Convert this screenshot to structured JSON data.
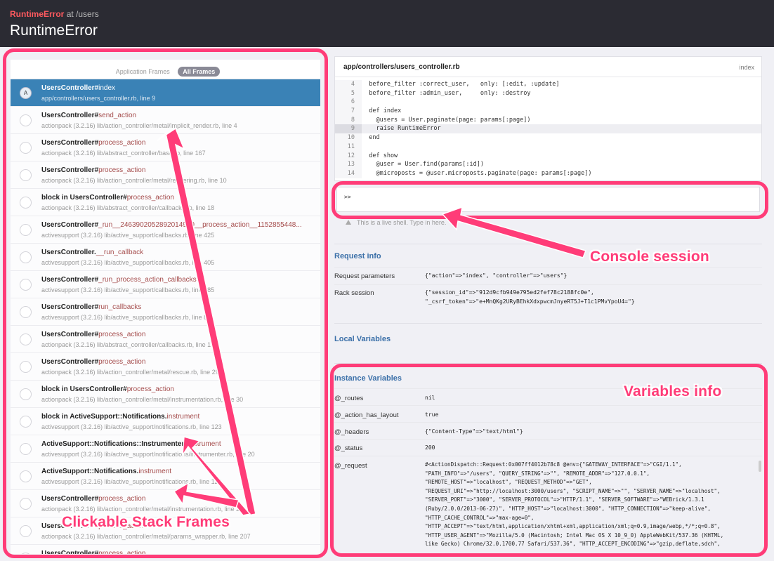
{
  "header": {
    "exception_class": "RuntimeError",
    "at_text": "at /users",
    "title": "RuntimeError"
  },
  "frames_panel": {
    "tabs": [
      "Application Frames",
      "All Frames"
    ],
    "active_tab": "All Frames",
    "frames": [
      {
        "cls": "UsersController",
        "sep": "#",
        "meth": "index",
        "loc": "app/controllers/users_controller.rb, line 9",
        "badge": "A",
        "selected": true
      },
      {
        "cls": "UsersController",
        "sep": "#",
        "meth": "send_action",
        "loc": "actionpack (3.2.16) lib/action_controller/metal/implicit_render.rb, line 4"
      },
      {
        "cls": "UsersController",
        "sep": "#",
        "meth": "process_action",
        "loc": "actionpack (3.2.16) lib/abstract_controller/base.rb, line 167"
      },
      {
        "cls": "UsersController",
        "sep": "#",
        "meth": "process_action",
        "loc": "actionpack (3.2.16) lib/action_controller/metal/rendering.rb, line 10"
      },
      {
        "cls": "block in UsersController",
        "sep": "#",
        "meth": "process_action",
        "loc": "actionpack (3.2.16) lib/abstract_controller/callbacks.rb, line 18"
      },
      {
        "cls": "UsersController",
        "sep": "#",
        "meth": "_run__2463902052892014980__process_action__1152855448...",
        "loc": "activesupport (3.2.16) lib/active_support/callbacks.rb, line 425"
      },
      {
        "cls": "UsersController",
        "sep": ".",
        "meth": "__run_callback",
        "loc": "activesupport (3.2.16) lib/active_support/callbacks.rb, line 405"
      },
      {
        "cls": "UsersController",
        "sep": "#",
        "meth": "_run_process_action_callbacks",
        "loc": "activesupport (3.2.16) lib/active_support/callbacks.rb, line 385"
      },
      {
        "cls": "UsersController",
        "sep": "#",
        "meth": "run_callbacks",
        "loc": "activesupport (3.2.16) lib/active_support/callbacks.rb, line 81"
      },
      {
        "cls": "UsersController",
        "sep": "#",
        "meth": "process_action",
        "loc": "actionpack (3.2.16) lib/abstract_controller/callbacks.rb, line 17"
      },
      {
        "cls": "UsersController",
        "sep": "#",
        "meth": "process_action",
        "loc": "actionpack (3.2.16) lib/action_controller/metal/rescue.rb, line 29"
      },
      {
        "cls": "block in UsersController",
        "sep": "#",
        "meth": "process_action",
        "loc": "actionpack (3.2.16) lib/action_controller/metal/instrumentation.rb, line 30"
      },
      {
        "cls": "block in ActiveSupport::Notifications",
        "sep": ".",
        "meth": "instrument",
        "loc": "activesupport (3.2.16) lib/active_support/notifications.rb, line 123"
      },
      {
        "cls": "ActiveSupport::Notifications::Instrumenter",
        "sep": "#",
        "meth": "instrument",
        "loc": "activesupport (3.2.16) lib/active_support/notifications/instrumenter.rb, line 20"
      },
      {
        "cls": "ActiveSupport::Notifications",
        "sep": ".",
        "meth": "instrument",
        "loc": "activesupport (3.2.16) lib/active_support/notifications.rb, line 123"
      },
      {
        "cls": "UsersController",
        "sep": "#",
        "meth": "process_action",
        "loc": "actionpack (3.2.16) lib/action_controller/metal/instrumentation.rb, line 29"
      },
      {
        "cls": "UsersController",
        "sep": "#",
        "meth": "process_action",
        "loc": "actionpack (3.2.16) lib/action_controller/metal/params_wrapper.rb, line 207"
      },
      {
        "cls": "UsersController",
        "sep": "#",
        "meth": "process_action",
        "loc": ""
      }
    ]
  },
  "code_panel": {
    "filename": "app/controllers/users_controller.rb",
    "index_label": "index",
    "highlight_line": "9",
    "lines": [
      {
        "n": "4",
        "t": "  before_filter :correct_user,   only: [:edit, :update]"
      },
      {
        "n": "5",
        "t": "  before_filter :admin_user,     only: :destroy"
      },
      {
        "n": "6",
        "t": ""
      },
      {
        "n": "7",
        "t": "  def index"
      },
      {
        "n": "8",
        "t": "    @users = User.paginate(page: params[:page])"
      },
      {
        "n": "9",
        "t": "    raise RuntimeError"
      },
      {
        "n": "10",
        "t": "  end"
      },
      {
        "n": "11",
        "t": ""
      },
      {
        "n": "12",
        "t": "  def show"
      },
      {
        "n": "13",
        "t": "    @user = User.find(params[:id])"
      },
      {
        "n": "14",
        "t": "    @microposts = @user.microposts.paginate(page: params[:page])"
      }
    ]
  },
  "console": {
    "prompt": ">>",
    "hint": "This is a live shell. Type in here."
  },
  "request_info": {
    "heading": "Request info",
    "rows": [
      {
        "k": "Request parameters",
        "v": "{\"action\"=>\"index\", \"controller\"=>\"users\"}"
      },
      {
        "k": "Rack session",
        "v": "{\"session_id\"=>\"912d9cfb949e795ed2fef78c2188fc0e\",\n\"_csrf_token\"=>\"e+MnQKg2URyBEhkXdxpwcmJnyeRT5J+T1c1PMvYpoU4=\"}"
      }
    ]
  },
  "local_variables": {
    "heading": "Local Variables"
  },
  "instance_variables": {
    "heading": "Instance Variables",
    "rows": [
      {
        "k": "@_routes",
        "v": "nil"
      },
      {
        "k": "@_action_has_layout",
        "v": "true"
      },
      {
        "k": "@_headers",
        "v": "{\"Content-Type\"=>\"text/html\"}"
      },
      {
        "k": "@_status",
        "v": "200"
      },
      {
        "k": "@_request",
        "v": "#<ActionDispatch::Request:0x007ff4012b78c8 @env={\"GATEWAY_INTERFACE\"=>\"CGI/1.1\",\n\"PATH_INFO\"=>\"/users\", \"QUERY_STRING\"=>\"\", \"REMOTE_ADDR\"=>\"127.0.0.1\",\n\"REMOTE_HOST\"=>\"localhost\", \"REQUEST_METHOD\"=>\"GET\",\n\"REQUEST_URI\"=>\"http://localhost:3000/users\", \"SCRIPT_NAME\"=>\"\", \"SERVER_NAME\"=>\"localhost\",\n\"SERVER_PORT\"=>\"3000\", \"SERVER_PROTOCOL\"=>\"HTTP/1.1\", \"SERVER_SOFTWARE\"=>\"WEBrick/1.3.1\n(Ruby/2.0.0/2013-06-27)\", \"HTTP_HOST\"=>\"localhost:3000\", \"HTTP_CONNECTION\"=>\"keep-alive\",\n\"HTTP_CACHE_CONTROL\"=>\"max-age=0\",\n\"HTTP_ACCEPT\"=>\"text/html,application/xhtml+xml,application/xml;q=0.9,image/webp,*/*;q=0.8\",\n\"HTTP_USER_AGENT\"=>\"Mozilla/5.0 (Macintosh; Intel Mac OS X 10_9_0) AppleWebKit/537.36 (KHTML,\nlike Gecko) Chrome/32.0.1700.77 Safari/537.36\", \"HTTP_ACCEPT_ENCODING\"=>\"gzip,deflate,sdch\","
      }
    ]
  },
  "annotations": {
    "console_label": "Console session",
    "variables_label": "Variables info",
    "frames_label": "Clickable Stack Frames",
    "color": "#ff3c78"
  },
  "colors": {
    "header_bg": "#2b2b33",
    "selected_frame": "#3a82b6",
    "section_heading": "#3a6fa8",
    "exception_red": "#ff5a5f"
  }
}
